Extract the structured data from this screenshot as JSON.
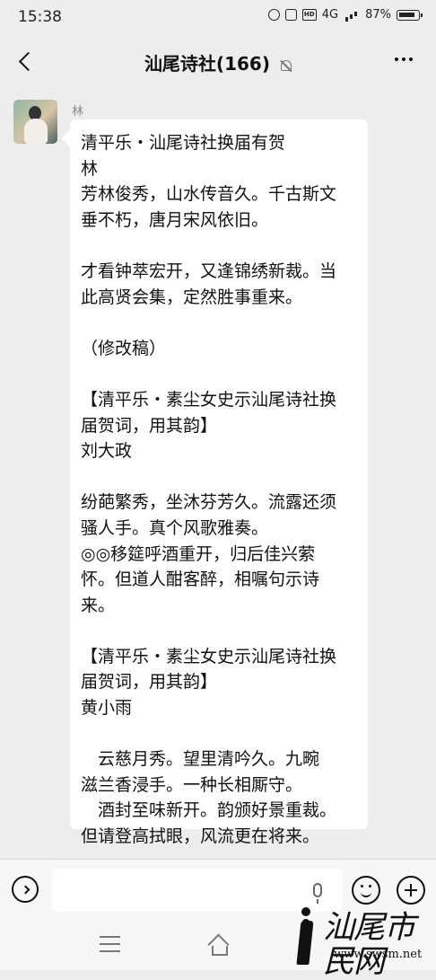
{
  "status_bar": {
    "time": "15:38",
    "network": "4G",
    "battery": "87%"
  },
  "header": {
    "title": "汕尾诗社(166)"
  },
  "message": {
    "sender": "林",
    "lines": [
      "清平乐・汕尾诗社换届有贺",
      "林",
      "芳林俊秀，山水传音久。千古斯文",
      "垂不朽，唐月宋风依旧。",
      "",
      "才看钟萃宏开，又逢锦绣新裁。当",
      "此高贤会集，定然胜事重来。",
      "",
      "（修改稿）",
      "",
      "【清平乐・素尘女史示汕尾诗社换",
      "届贺词，用其韵】",
      "刘大政",
      "",
      "纷葩繁秀，坐沐芬芳久。流露还须",
      "骚人手。真个风歌雅奏。",
      "◎◎移筵呼酒重开，归后佳兴萦",
      "怀。但道人酣客醉，相嘱句示诗",
      "来。",
      "",
      "【清平乐・素尘女史示汕尾诗社换",
      "届贺词，用其韵】",
      "黄小雨",
      "",
      "　云慈月秀。望里清吟久。九畹",
      "滋兰香浸手。一种长相厮守。",
      "　酒封至味新开。韵颁好景重裁。",
      "但请登高拭眼，风流更在将来。"
    ]
  },
  "watermark": {
    "title": "汕尾市民网",
    "url": "www.swsm.net"
  },
  "icons": {
    "back": "chevron-left-icon",
    "mute": "bell-off-icon",
    "more": "more-horizontal-icon",
    "voice": "voice-icon",
    "mic": "microphone-icon",
    "emoji": "emoji-icon",
    "plus": "plus-icon",
    "menu": "menu-icon",
    "home": "home-icon"
  }
}
